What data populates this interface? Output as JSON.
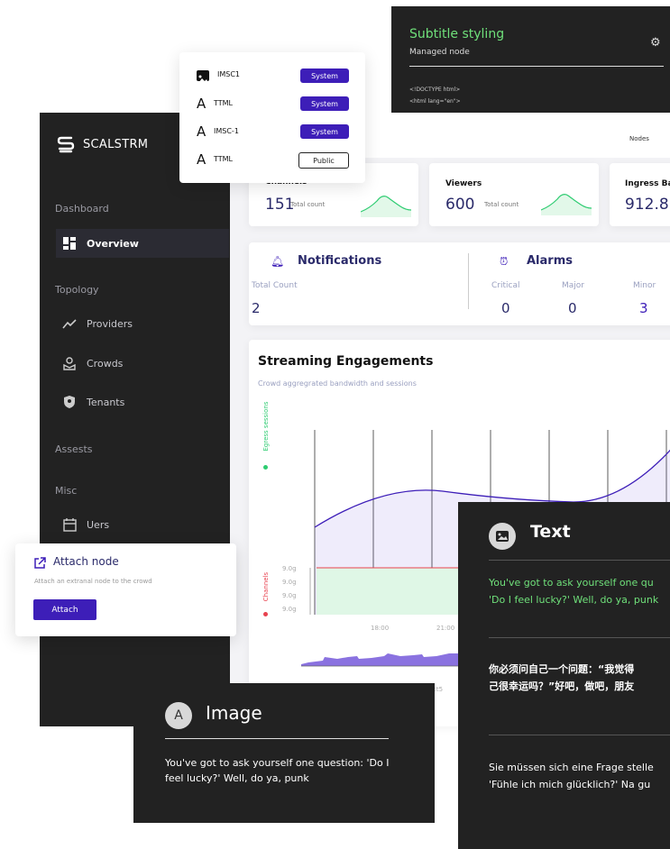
{
  "subtitle_panel": {
    "title": "Subtitle styling",
    "subtitle": "Managed node",
    "code_line1": "<!DOCTYPE html>",
    "code_line2": "<html lang=\"en\">"
  },
  "format_list": [
    {
      "icon": "image-icon",
      "name": "IMSC1",
      "badge": "System",
      "type": "system"
    },
    {
      "icon": "letter-a-icon",
      "name": "TTML",
      "badge": "System",
      "type": "system"
    },
    {
      "icon": "letter-a-icon",
      "name": "IMSC-1",
      "badge": "System",
      "type": "system"
    },
    {
      "icon": "letter-a-icon",
      "name": "TTML",
      "badge": "Public",
      "type": "public"
    }
  ],
  "sidebar": {
    "brand": "SCALSTRM",
    "sections": {
      "dashboard": "Dashboard",
      "topology": "Topology",
      "assests": "Assests",
      "misc": "Misc"
    },
    "items": {
      "overview": "Overview",
      "providers": "Providers",
      "crowds": "Crowds",
      "tenants": "Tenants",
      "users": "Uers"
    }
  },
  "header": {
    "nodes": "Nodes"
  },
  "stats": {
    "channels": {
      "title": "Channels",
      "value": "151",
      "sub": "Total count"
    },
    "viewers": {
      "title": "Viewers",
      "value": "600",
      "sub": "Total count"
    },
    "ingress": {
      "title": "Ingress Ban",
      "value": "912.8"
    }
  },
  "notifications": {
    "title": "Notifications",
    "total_label": "Total Count",
    "total_value": "2"
  },
  "alarms": {
    "title": "Alarms",
    "critical_label": "Critical",
    "critical_value": "0",
    "major_label": "Major",
    "major_value": "0",
    "minor_label": "Minor",
    "minor_value": "3"
  },
  "engagement": {
    "title": "Streaming Engagements",
    "subtitle": "Crowd aggregrated bandwidth and sessions",
    "egress_label": "Egress sessions",
    "channels_label": "Channels",
    "y_ticks": [
      "9.0g",
      "9.0g",
      "9.0g",
      "9.0g"
    ],
    "x_ticks": [
      "18:00",
      "21:00"
    ],
    "mini_tick": "ct5"
  },
  "attach": {
    "title": "Attach node",
    "description": "Attach an extranal node to the crowd",
    "button": "Attach"
  },
  "text_panel": {
    "title": "Text",
    "english": "You've got to ask yourself one qu",
    "english2": "'Do I feel lucky?' Well, do ya, punk",
    "chinese": "你必须问自己一个问题：“我觉得",
    "chinese2": "己很幸运吗？”好吧，做吧，朋友",
    "german": "Sie müssen sich eine Frage stelle",
    "german2": "'Fühle ich mich glücklich?' Na gu"
  },
  "image_panel": {
    "avatar_letter": "A",
    "title": "Image",
    "text": "You've got to ask yourself one question: 'Do I feel lucky?' Well, do ya, punk"
  },
  "colors": {
    "accent": "#3d1eb8",
    "green": "#2ecc71",
    "red": "#e8424f",
    "dark": "#222222"
  }
}
